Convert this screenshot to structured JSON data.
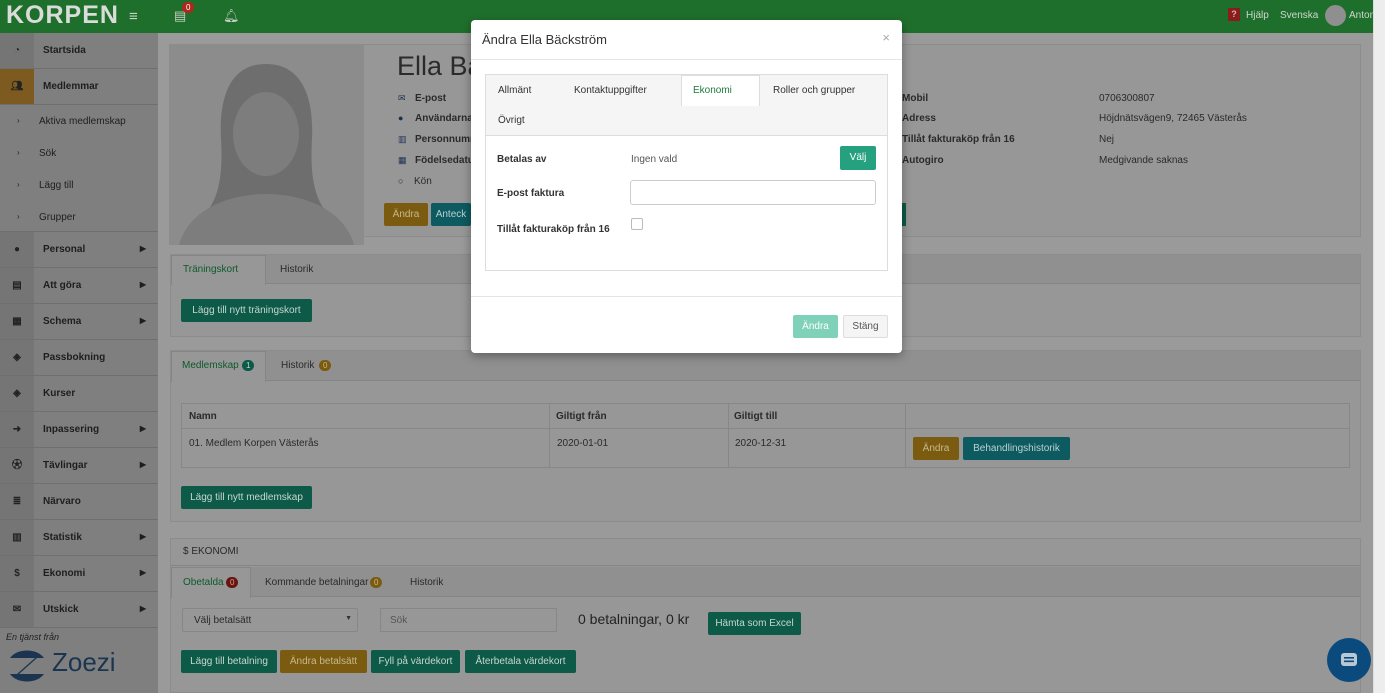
{
  "topbar": {
    "logo": "KORPEN",
    "notif_badge": "0",
    "help": "Hjälp",
    "language": "Svenska",
    "user": "Anton"
  },
  "sidebar": {
    "items": [
      {
        "label": "Startsida",
        "icon": "dashboard-icon"
      },
      {
        "label": "Medlemmar",
        "icon": "users-icon"
      },
      {
        "label": "Personal",
        "icon": "user-icon"
      },
      {
        "label": "Att göra",
        "icon": "list-icon"
      },
      {
        "label": "Schema",
        "icon": "calendar-icon"
      },
      {
        "label": "Passbokning",
        "icon": "tag-icon"
      },
      {
        "label": "Kurser",
        "icon": "tag-icon"
      },
      {
        "label": "Inpassering",
        "icon": "sign-in-icon"
      },
      {
        "label": "Tävlingar",
        "icon": "soccer-ball-icon"
      },
      {
        "label": "Närvaro",
        "icon": "list-icon"
      },
      {
        "label": "Statistik",
        "icon": "bar-chart-icon"
      },
      {
        "label": "Ekonomi",
        "icon": "dollar-icon"
      },
      {
        "label": "Utskick",
        "icon": "envelope-icon"
      }
    ],
    "subitems": [
      "Aktiva medlemskap",
      "Sök",
      "Lägg till",
      "Grupper"
    ],
    "powered_by": "En tjänst från",
    "brand": "Zoezi"
  },
  "profile": {
    "name": "Ella Bä",
    "fields_left": [
      "E-post",
      "Användarna",
      "Personnumm",
      "Födelsedatu",
      "Kön"
    ],
    "fields_right": [
      {
        "label": "Mobil",
        "value": "0706300807"
      },
      {
        "label": "Adress",
        "value": "Höjdnätsvägen9, 72465 Västerås"
      },
      {
        "label": "Tillåt fakturaköp från 16",
        "value": "Nej"
      },
      {
        "label": "Autogiro",
        "value": "Medgivande saknas"
      }
    ],
    "edit_button": "Ändra",
    "notes_button": "Anteck"
  },
  "training": {
    "tabs": [
      "Träningskort",
      "Historik"
    ],
    "add_button": "Lägg till nytt träningskort"
  },
  "membership": {
    "tab_active": "Medlemskap",
    "tab_active_count": "1",
    "tab_history": "Historik",
    "tab_history_count": "0",
    "columns": [
      "Namn",
      "Giltigt från",
      "Giltigt till"
    ],
    "row": {
      "name": "01. Medlem Korpen Västerås",
      "from": "2020-01-01",
      "to": "2020-12-31"
    },
    "edit_button": "Ändra",
    "history_button": "Behandlingshistorik",
    "add_button": "Lägg till nytt medlemskap"
  },
  "economy": {
    "heading": "$ EKONOMI",
    "tabs": [
      {
        "label": "Obetalda",
        "count": "0"
      },
      {
        "label": "Kommande betalningar",
        "count": "0"
      },
      {
        "label": "Historik",
        "count": ""
      }
    ],
    "payment_select": "Välj betalsätt",
    "search_placeholder": "Sök",
    "summary": "0 betalningar, 0 kr",
    "excel_button": "Hämta som Excel",
    "buttons": [
      "Lägg till betalning",
      "Ändra betalsätt",
      "Fyll på värdekort",
      "Återbetala värdekort"
    ]
  },
  "modal": {
    "title": "Ändra Ella Bäckström",
    "close": "×",
    "tabs": [
      "Allmänt",
      "Kontaktuppgifter",
      "Ekonomi",
      "Roller och grupper",
      "Övrigt"
    ],
    "active_tab": "Ekonomi",
    "paid_by_label": "Betalas av",
    "paid_by_value": "Ingen vald",
    "choose_button": "Välj",
    "email_invoice_label": "E-post faktura",
    "email_invoice_value": "",
    "allow_invoice_label": "Tillåt fakturaköp från 16",
    "save_button": "Ändra",
    "close_button": "Stäng"
  },
  "colors": {
    "topbar": "#1f6f2c",
    "accent_green": "#26a17f",
    "active_tab_text": "#1e7b3a"
  }
}
